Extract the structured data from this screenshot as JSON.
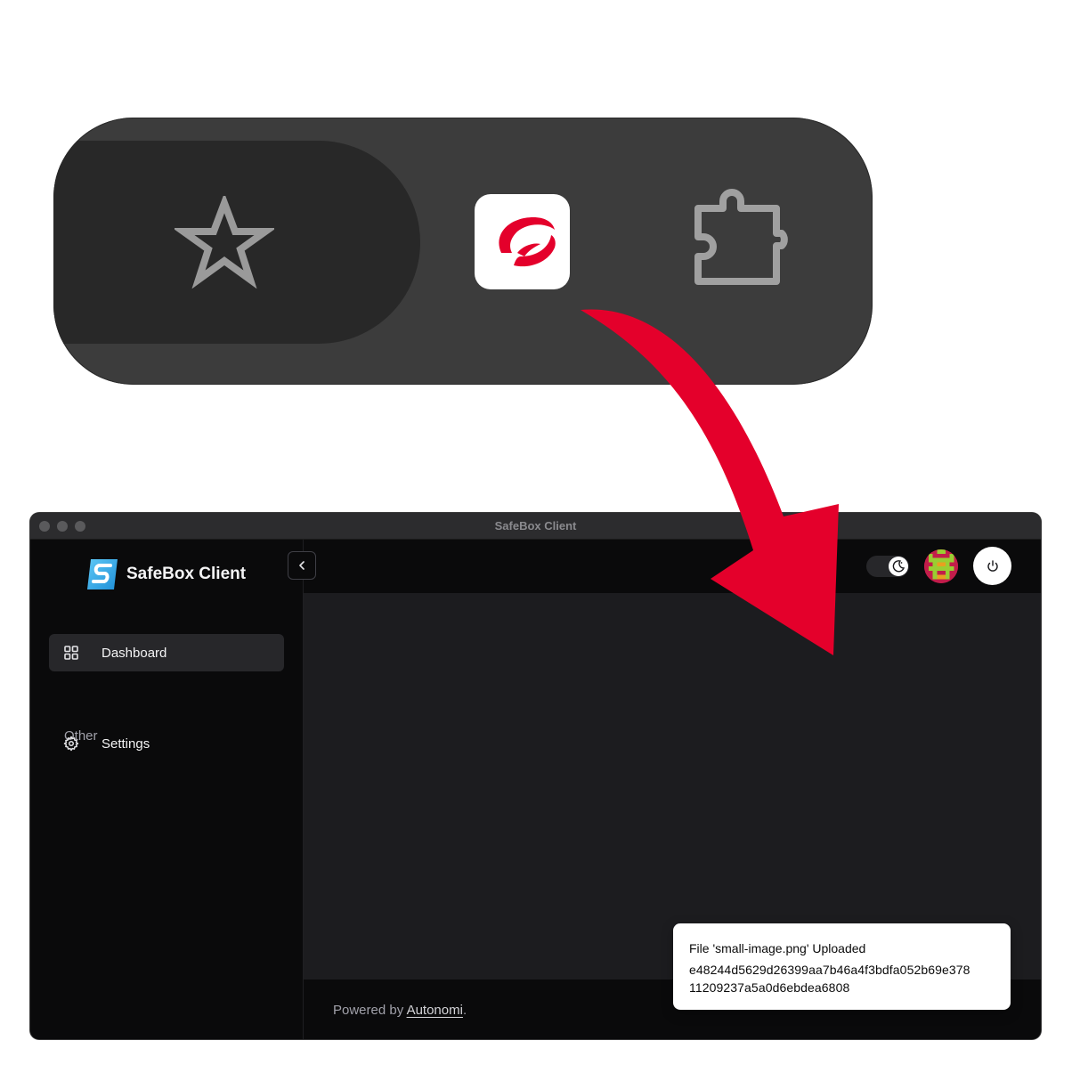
{
  "toolbar": {
    "icons": [
      "star-icon",
      "extension-logo-icon",
      "puzzle-icon"
    ],
    "accent_color": "#e4002b"
  },
  "window": {
    "title": "SafeBox Client"
  },
  "sidebar": {
    "brand": "SafeBox Client",
    "items": [
      {
        "label": "Dashboard",
        "icon": "grid-icon",
        "active": true
      }
    ],
    "section_label": "Other",
    "other_items": [
      {
        "label": "Settings",
        "icon": "gear-icon"
      }
    ]
  },
  "header": {
    "theme_toggle": "dark",
    "avatar": "avatar",
    "power": "power-icon"
  },
  "footer": {
    "prefix": "Powered by ",
    "link": "Autonomi",
    "suffix": "."
  },
  "toast": {
    "title": "File 'small-image.png' Uploaded",
    "hash_line1": "e48244d5629d26399aa7b46a4f3bdfa052b69e378",
    "hash_line2": "11209237a5a0d6ebdea6808"
  }
}
